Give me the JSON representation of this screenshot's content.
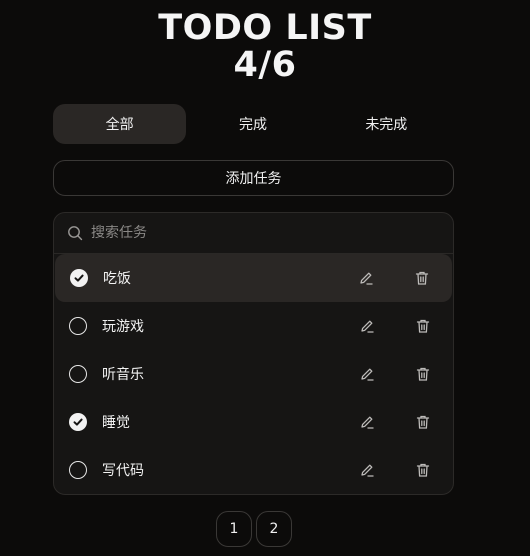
{
  "title": {
    "line1": "TODO LIST",
    "line2": "4/6"
  },
  "tabs": [
    {
      "label": "全部",
      "active": true
    },
    {
      "label": "完成",
      "active": false
    },
    {
      "label": "未完成",
      "active": false
    }
  ],
  "add_button": {
    "label": "添加任务"
  },
  "search": {
    "placeholder": "搜索任务",
    "value": ""
  },
  "todos": [
    {
      "label": "吃饭",
      "done": true,
      "hovered": true
    },
    {
      "label": "玩游戏",
      "done": false
    },
    {
      "label": "听音乐",
      "done": false
    },
    {
      "label": "睡觉",
      "done": true
    },
    {
      "label": "写代码",
      "done": false
    }
  ],
  "pagination": {
    "pages": [
      "1",
      "2"
    ]
  },
  "icons": {
    "search": "search-icon",
    "edit": "pencil-icon",
    "delete": "trash-icon",
    "checked": "check-circle-icon",
    "unchecked": "circle-icon"
  },
  "colors": {
    "background": "#0c0b0a",
    "panel": "#161514",
    "active": "#2a2725",
    "text": "#f2f2f2"
  }
}
